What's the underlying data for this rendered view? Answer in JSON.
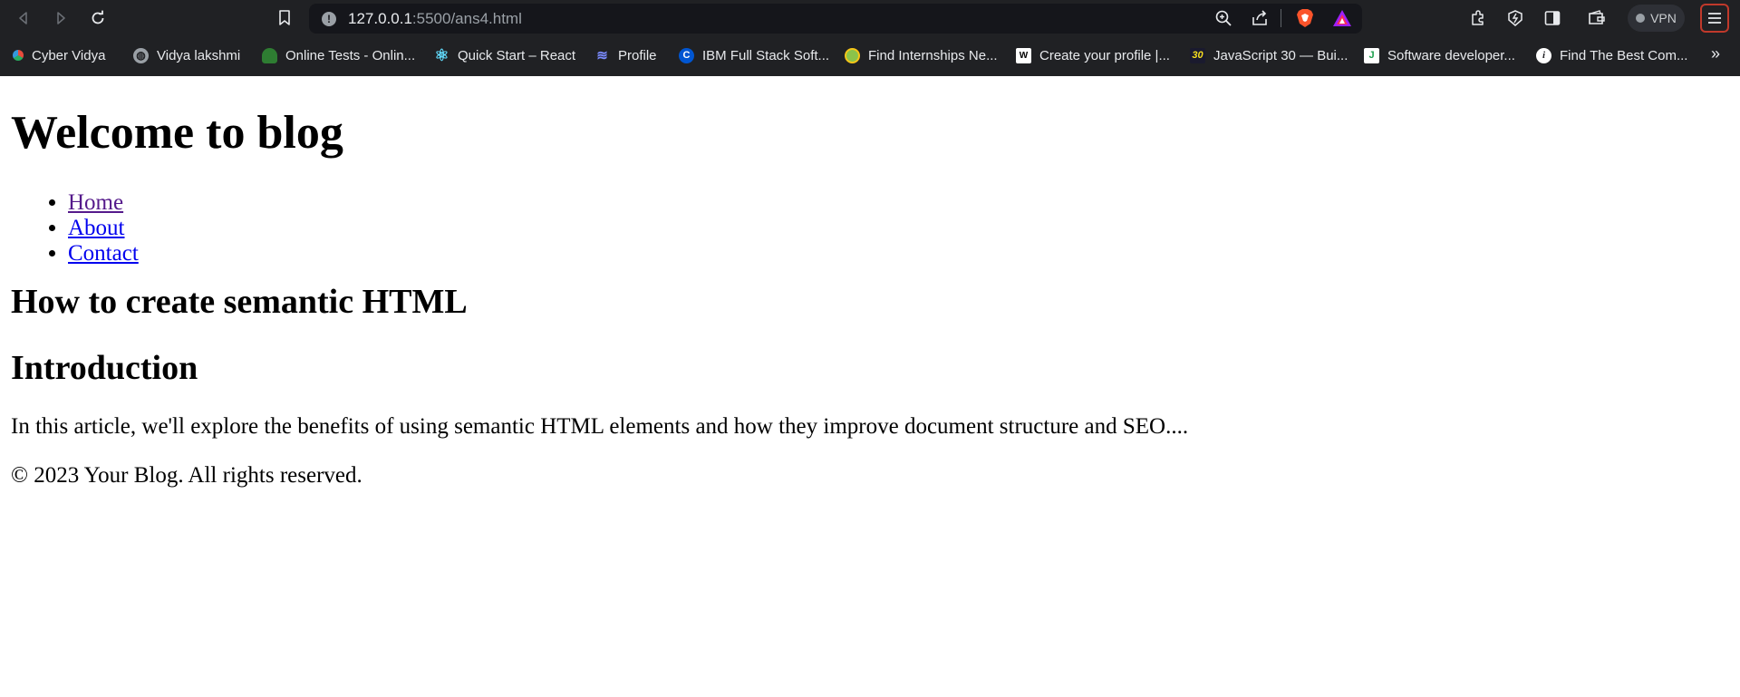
{
  "browser": {
    "url_host": "127.0.0.1",
    "url_rest": ":5500/ans4.html",
    "vpn_label": "VPN",
    "icons": {
      "back": "back-arrow-icon",
      "forward": "forward-arrow-icon",
      "reload": "reload-icon",
      "bookmark": "bookmark-icon",
      "site_info": "site-info-icon",
      "zoom": "zoom-icon",
      "share": "share-icon",
      "brave": "brave-shield-icon",
      "rewards": "brave-rewards-icon",
      "extensions": "extensions-icon",
      "leo": "leo-icon",
      "sidebar": "sidebar-icon",
      "wallet": "wallet-icon",
      "menu": "menu-icon"
    },
    "bookmarks": [
      {
        "label": "Cyber Vidya"
      },
      {
        "label": "Vidya lakshmi"
      },
      {
        "label": "Online Tests - Onlin..."
      },
      {
        "label": "Quick Start – React"
      },
      {
        "label": "Profile"
      },
      {
        "label": "IBM Full Stack Soft..."
      },
      {
        "label": "Find Internships Ne..."
      },
      {
        "label": "Create your profile |..."
      },
      {
        "label": "JavaScript 30 — Bui..."
      },
      {
        "label": "Software developer..."
      },
      {
        "label": "Find The Best Com..."
      }
    ],
    "bookmarks_more": "»"
  },
  "page": {
    "title": "Welcome to blog",
    "nav": [
      {
        "label": "Home"
      },
      {
        "label": "About"
      },
      {
        "label": "Contact"
      }
    ],
    "article_title": "How to create semantic HTML",
    "section_title": "Introduction",
    "section_text": "In this article, we'll explore the benefits of using semantic HTML elements and how they improve document structure and SEO....",
    "footer": "© 2023 Your Blog. All rights reserved."
  }
}
